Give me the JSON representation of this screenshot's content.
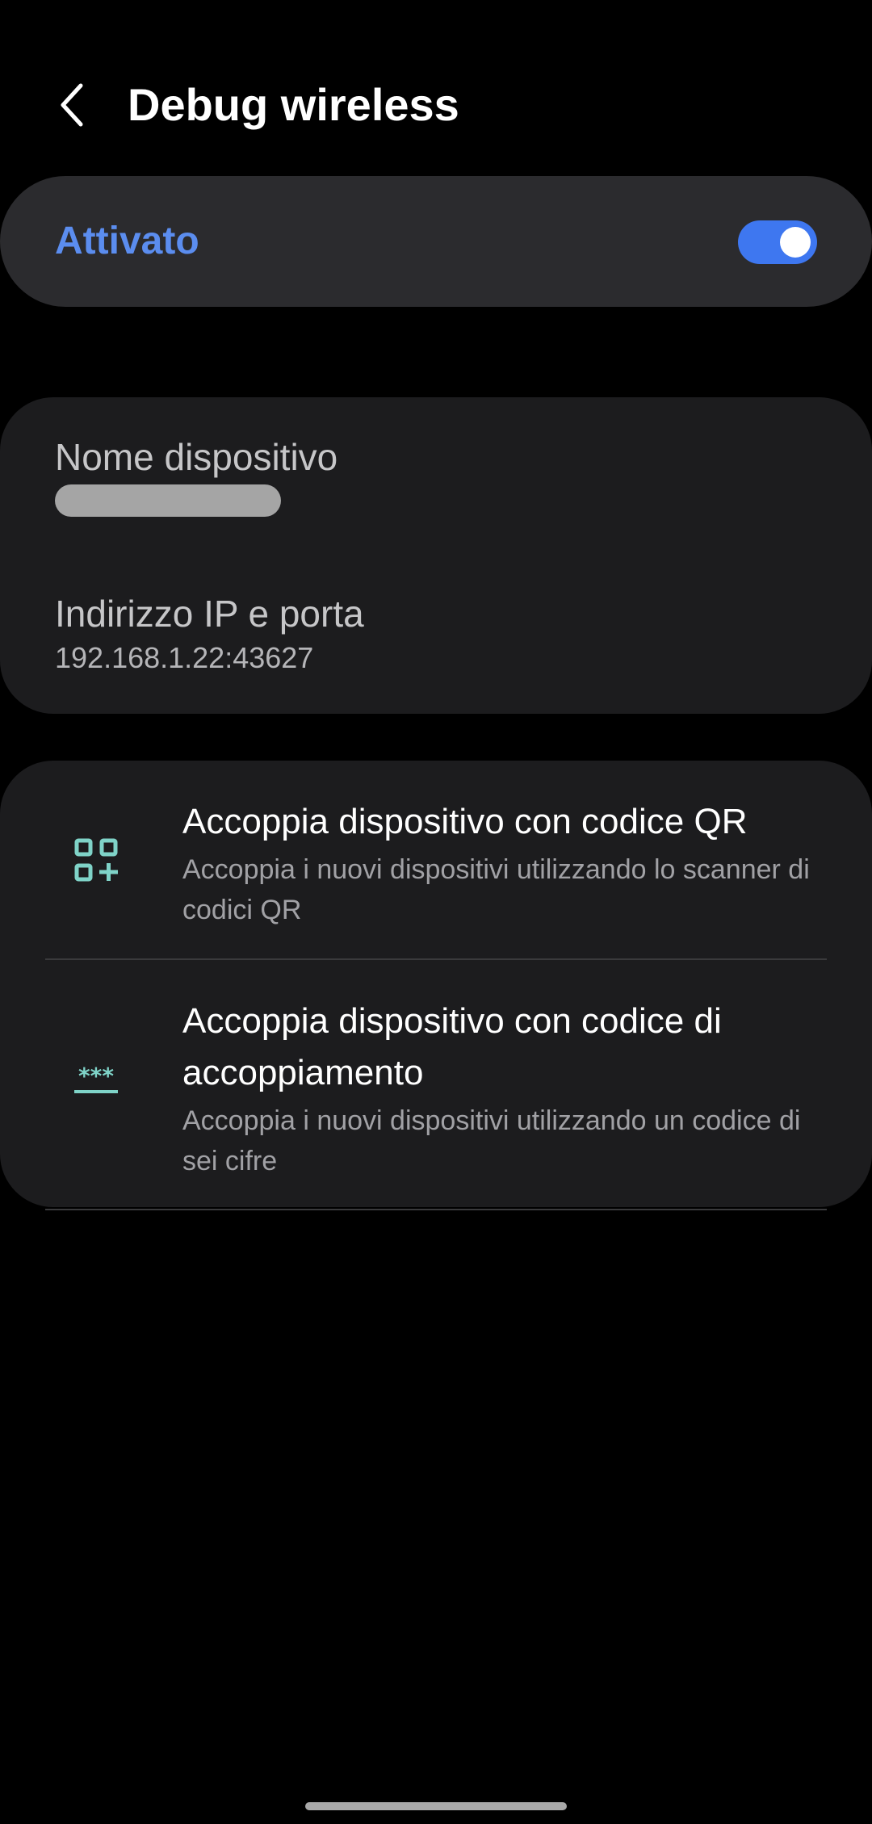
{
  "header": {
    "title": "Debug wireless",
    "back_icon": "chevron-left-icon"
  },
  "master_switch": {
    "label": "Attivato",
    "checked": true,
    "label_color": "#5b8def",
    "track_color": "#3e77f0"
  },
  "device_info": {
    "name_title": "Nome dispositivo",
    "ip_title": "Indirizzo IP e porta",
    "ip_value": "192.168.1.22:43627"
  },
  "pairing": {
    "items": [
      {
        "title": "Accoppia dispositivo con codice QR",
        "subtitle": "Accoppia i nuovi dispositivi utilizzando lo scanner di codici QR",
        "icon": "qr-code-icon"
      },
      {
        "title": "Accoppia dispositivo con codice di accoppiamento",
        "subtitle": "Accoppia i nuovi dispositivi utilizzando un codice di sei cifre",
        "icon": "pin-code-icon"
      }
    ],
    "icon_color": "#7fd3c8"
  }
}
